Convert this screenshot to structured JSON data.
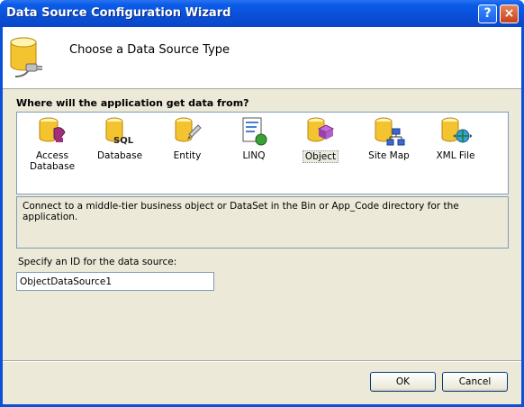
{
  "window": {
    "title": "Data Source Configuration Wizard"
  },
  "titlebar_buttons": {
    "help": "?",
    "close": "×"
  },
  "header": {
    "title": "Choose a Data Source Type",
    "icon": "database-connect-icon"
  },
  "section": {
    "label": "Where will the application get data from?"
  },
  "data_types": [
    {
      "label": "Access Database",
      "icon": "access-database-icon",
      "selected": false
    },
    {
      "label": "Database",
      "icon": "sql-database-icon",
      "selected": false
    },
    {
      "label": "Entity",
      "icon": "entity-icon",
      "selected": false
    },
    {
      "label": "LINQ",
      "icon": "linq-icon",
      "selected": false
    },
    {
      "label": "Object",
      "icon": "object-icon",
      "selected": true
    },
    {
      "label": "Site Map",
      "icon": "site-map-icon",
      "selected": false
    },
    {
      "label": "XML File",
      "icon": "xml-file-icon",
      "selected": false
    }
  ],
  "description": "Connect to a middle-tier business object or DataSet in the Bin or App_Code directory for the application.",
  "id_field": {
    "label": "Specify an ID for the data source:",
    "value": "ObjectDataSource1"
  },
  "buttons": {
    "ok": "OK",
    "cancel": "Cancel"
  }
}
